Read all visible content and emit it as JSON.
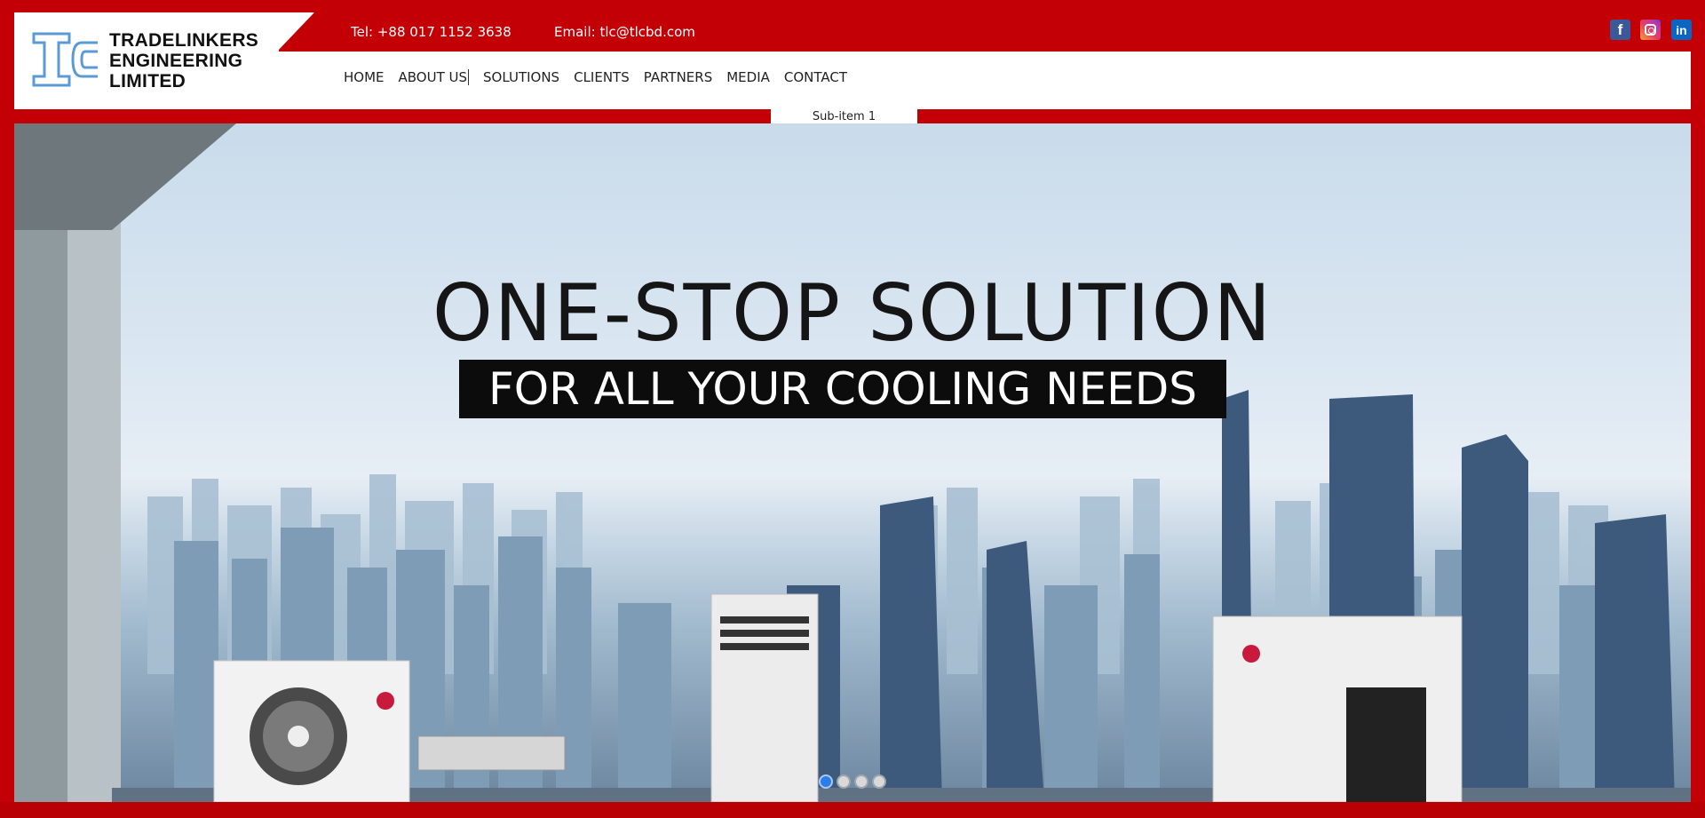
{
  "brand": {
    "logo_icon": "tc-monogram-icon",
    "name_lines": [
      "TRADELINKERS",
      "ENGINEERING",
      "LIMITED"
    ]
  },
  "contact": {
    "tel": "Tel: +88 017 1152 3638",
    "email": "Email: tlc@tlcbd.com"
  },
  "social": [
    {
      "name": "facebook-icon",
      "glyph": "f"
    },
    {
      "name": "instagram-icon",
      "glyph": ""
    },
    {
      "name": "linkedin-icon",
      "glyph": "in"
    }
  ],
  "nav": {
    "items": [
      "HOME",
      "ABOUT US",
      "SOLUTIONS",
      "CLIENTS",
      "PARTNERS",
      "MEDIA",
      "CONTACT"
    ],
    "active": "ABOUT US",
    "submenu": [
      "Sub-item 1"
    ]
  },
  "hero": {
    "headline": "ONE-STOP SOLUTION",
    "subheadline": "FOR ALL YOUR COOLING NEEDS",
    "slides_total": 4,
    "active_slide": 1
  },
  "colors": {
    "brand_red": "#c30005",
    "logo_blue": "#5b9bd5",
    "dot_active": "#2b7de9"
  }
}
